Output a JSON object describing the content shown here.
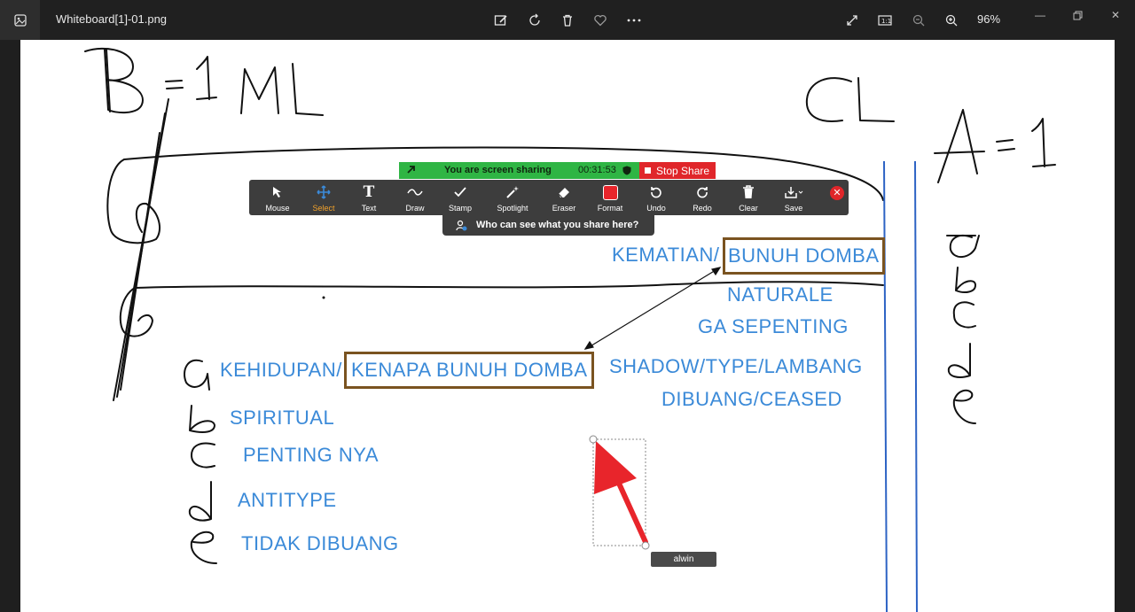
{
  "window": {
    "title": "Whiteboard[1]-01.png",
    "zoom": "96%",
    "toolbar_icons": [
      "edit-image-icon",
      "rotate-icon",
      "delete-icon",
      "favorite-icon",
      "more-icon"
    ],
    "right_icons": [
      "fullscreen-icon",
      "actual-size-icon",
      "zoom-out-icon",
      "zoom-in-icon"
    ]
  },
  "board": {
    "handwriting": {
      "b_eq_1": "B = 1",
      "ml": "ML",
      "cl": "CL",
      "a_eq_1": "A = 1"
    },
    "left_items": [
      {
        "letter": "a",
        "text": "KEHIDUPAN/"
      },
      {
        "letter": "b",
        "text": "SPIRITUAL"
      },
      {
        "letter": "c",
        "text": "PENTING NYA"
      },
      {
        "letter": "d",
        "text": "ANTITYPE"
      },
      {
        "letter": "e",
        "text": "TIDAK DIBUANG"
      }
    ],
    "left_boxed": "KENAPA BUNUH DOMBA",
    "right_top_plain": "KEMATIAN/",
    "right_top_boxed": "BUNUH DOMBA",
    "right_items": [
      "NATURALE",
      "GA SEPENTING",
      "SHADOW/TYPE/LAMBANG",
      "DIBUANG/CEASED"
    ],
    "far_right_letters": [
      "a",
      "b",
      "c",
      "d",
      "e"
    ]
  },
  "zoom": {
    "share_status": "You are screen sharing",
    "timer": "00:31:53",
    "stop_share": "Stop Share",
    "tools": [
      "Mouse",
      "Select",
      "Text",
      "Draw",
      "Stamp",
      "Spotlight",
      "Eraser",
      "Format",
      "Undo",
      "Redo",
      "Clear",
      "Save"
    ],
    "active_tool": "Select",
    "who_can_see": "Who can see what you share here?",
    "annotator": "alwin",
    "colors": {
      "green": "#2fb544",
      "red": "#e0262a",
      "select": "#f0a12b",
      "text_blue": "#3b8ad8",
      "box": "#7a5320"
    }
  }
}
